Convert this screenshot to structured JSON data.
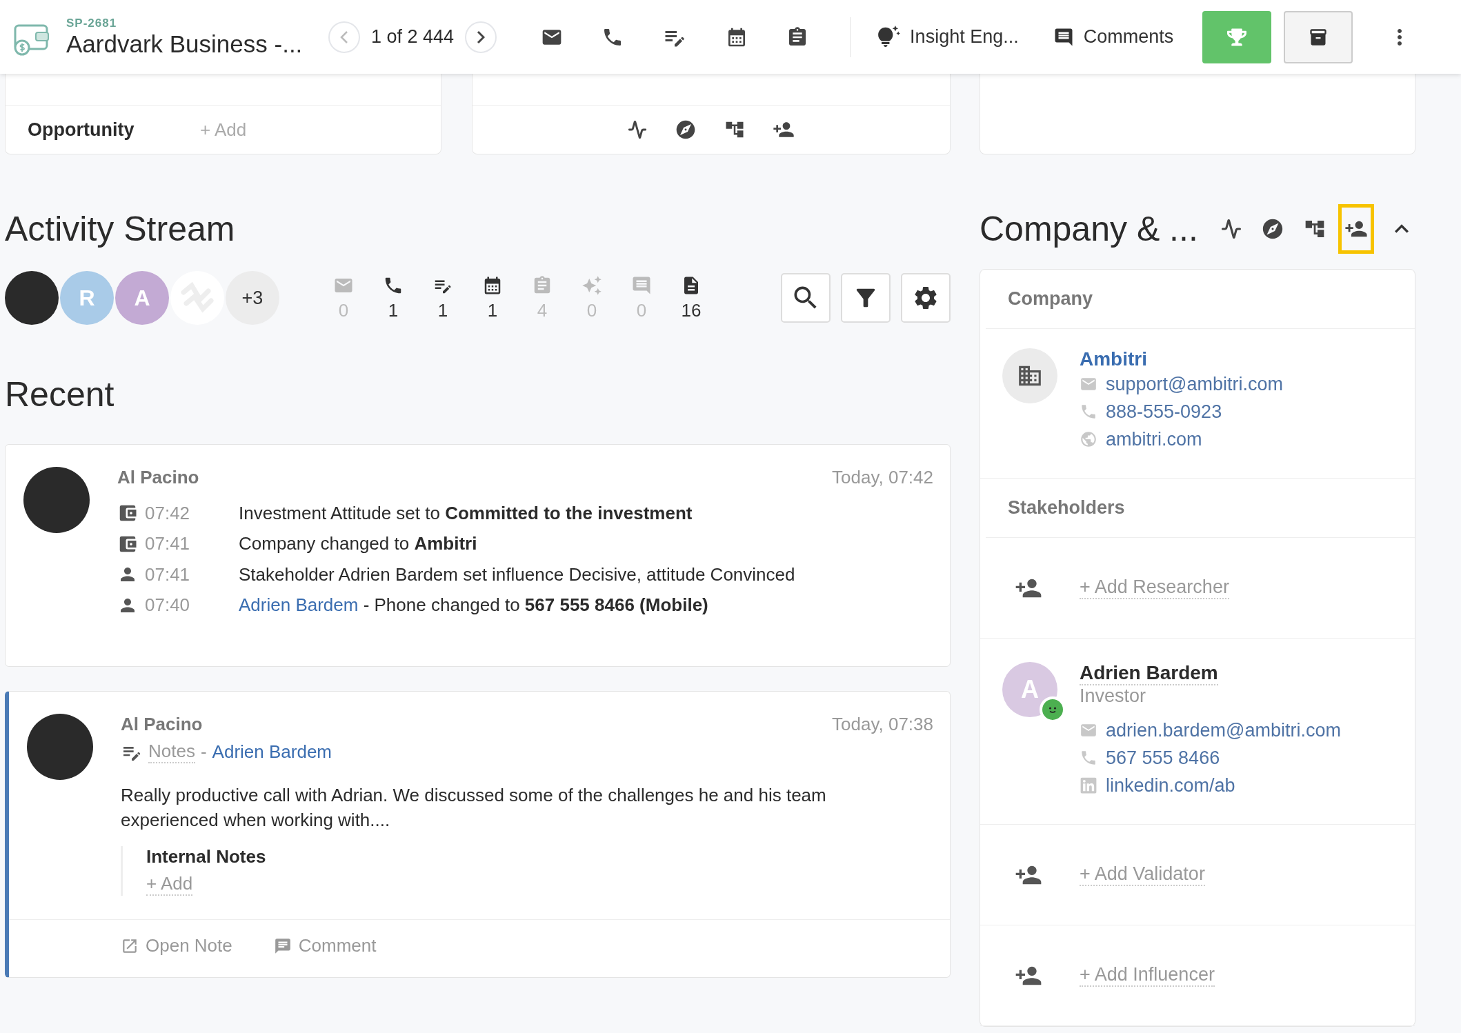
{
  "header": {
    "record_id": "SP-2681",
    "title": "Aardvark Business -...",
    "pager": "1 of 2 444",
    "insight": "Insight Eng...",
    "comments": "Comments"
  },
  "top_card": {
    "label": "Opportunity",
    "action": "+ Add"
  },
  "activity": {
    "title": "Activity Stream",
    "participants": [
      {
        "kind": "photo"
      },
      {
        "kind": "initial",
        "initial": "R",
        "color": "#a9cbe8"
      },
      {
        "kind": "initial",
        "initial": "A",
        "color": "#c3aad4"
      },
      {
        "kind": "logo"
      },
      {
        "kind": "more",
        "label": "+3"
      }
    ],
    "counters": [
      {
        "kind": "email",
        "count": "0",
        "active": false
      },
      {
        "kind": "phone",
        "count": "1",
        "active": true
      },
      {
        "kind": "note",
        "count": "1",
        "active": true
      },
      {
        "kind": "meeting",
        "count": "1",
        "active": true
      },
      {
        "kind": "task",
        "count": "4",
        "active": false
      },
      {
        "kind": "insight",
        "count": "0",
        "active": false
      },
      {
        "kind": "comment",
        "count": "0",
        "active": false
      },
      {
        "kind": "document",
        "count": "16",
        "active": true
      }
    ]
  },
  "recent": {
    "title": "Recent",
    "entries": [
      {
        "kind": "changes",
        "author": "Al Pacino",
        "time": "Today, 07:42",
        "highlighted": false,
        "changes": [
          {
            "kind": "deal",
            "time": "07:42",
            "text": "Investment Attitude set to **Committed to the investment**"
          },
          {
            "kind": "deal",
            "time": "07:41",
            "text": "Company changed to **Ambitri**"
          },
          {
            "kind": "person",
            "time": "07:41",
            "text": "Stakeholder Adrien Bardem set influence Decisive, attitude Convinced"
          },
          {
            "kind": "person",
            "time": "07:40",
            "link": "Adrien Bardem",
            "text": " - Phone changed to **567 555 8466 (Mobile)**"
          }
        ]
      },
      {
        "kind": "note",
        "author": "Al Pacino",
        "time": "Today, 07:38",
        "highlighted": true,
        "type": "Notes",
        "separator": "-",
        "link": "Adrien Bardem",
        "body": "Really productive call with Adrian. We discussed some of the challenges he and his team experienced when working with....",
        "internal_title": "Internal Notes",
        "internal_action": "+ Add",
        "actions": [
          {
            "kind": "open",
            "label": "Open Note"
          },
          {
            "kind": "comment",
            "label": "Comment"
          }
        ]
      }
    ]
  },
  "side": {
    "title": "Company & ...",
    "tools": [
      {
        "kind": "activity",
        "selected": false
      },
      {
        "kind": "compass",
        "selected": false
      },
      {
        "kind": "hierarchy",
        "selected": false
      },
      {
        "kind": "add-person",
        "selected": true
      }
    ],
    "company_heading": "Company",
    "company": {
      "name": "Ambitri",
      "contacts": [
        {
          "kind": "email",
          "value": "support@ambitri.com"
        },
        {
          "kind": "phone",
          "value": "888-555-0923"
        },
        {
          "kind": "web",
          "value": "ambitri.com"
        }
      ]
    },
    "stakeholders_heading": "Stakeholders",
    "stakeholders": [
      {
        "kind": "add",
        "label": "+ Add Researcher"
      },
      {
        "kind": "person",
        "initial": "A",
        "name": "Adrien Bardem",
        "role": "Investor",
        "contacts": [
          {
            "kind": "email",
            "value": "adrien.bardem@ambitri.com"
          },
          {
            "kind": "phone",
            "value": "567 555 8466"
          },
          {
            "kind": "linkedin",
            "value": "linkedin.com/ab"
          }
        ]
      },
      {
        "kind": "add",
        "label": "+ Add Validator"
      },
      {
        "kind": "add",
        "label": "+ Add Influencer"
      }
    ]
  }
}
